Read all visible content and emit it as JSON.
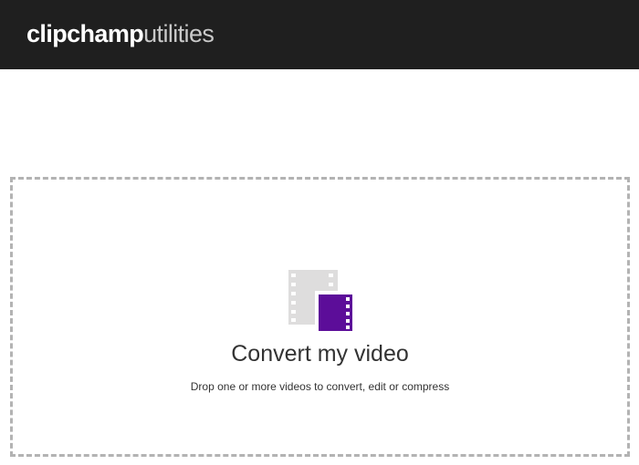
{
  "header": {
    "logo_brand": "clipchamp",
    "logo_product": "utilities",
    "background_color": "#1f1f1f"
  },
  "dropzone": {
    "icon": "video-file-icon",
    "title": "Convert my video",
    "subtitle": "Drop one or more videos to convert, edit or compress",
    "accent_color": "#5c0d99",
    "border_color": "#b3b3b3"
  }
}
